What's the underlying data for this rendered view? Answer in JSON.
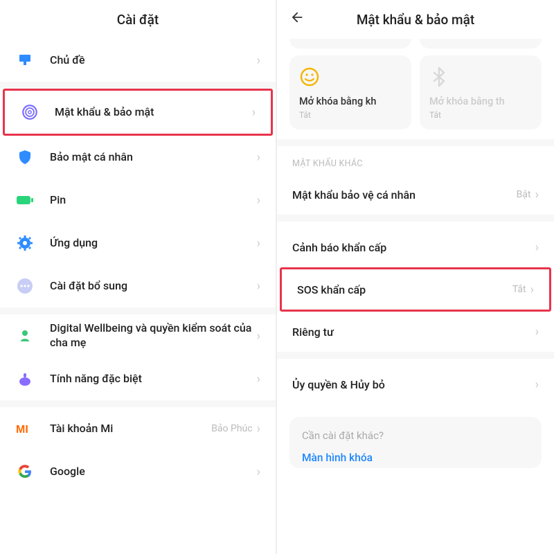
{
  "left": {
    "title": "Cài đặt",
    "items": [
      {
        "icon": "theme",
        "label": "Chủ đề"
      },
      {
        "icon": "fingerprint",
        "label": "Mật khẩu & bảo mật",
        "highlight": true
      },
      {
        "icon": "shield",
        "label": "Bảo mật cá nhân"
      },
      {
        "icon": "battery",
        "label": "Pin"
      },
      {
        "icon": "apps",
        "label": "Ứng dụng"
      },
      {
        "icon": "more",
        "label": "Cài đặt bổ sung"
      },
      {
        "icon": "wellbeing",
        "label": "Digital Wellbeing và quyền kiểm soát của cha mẹ"
      },
      {
        "icon": "special",
        "label": "Tính năng đặc biệt"
      },
      {
        "icon": "mi",
        "label": "Tài khoản Mi",
        "value": "Bảo Phúc"
      },
      {
        "icon": "google",
        "label": "Google"
      }
    ]
  },
  "right": {
    "title": "Mật khẩu & bảo mật",
    "cards": [
      {
        "icon": "smile",
        "title": "Mở khóa bằng kh",
        "sub": "Tắt",
        "disabled": false
      },
      {
        "icon": "bluetooth",
        "title": "Mở khóa bằng th",
        "sub": "Tắt",
        "disabled": true
      }
    ],
    "section_header": "MẬT KHẨU KHÁC",
    "rows": [
      {
        "label": "Mật khẩu bảo vệ cá nhân",
        "value": "Bật"
      },
      {
        "label": "Cảnh báo khẩn cấp",
        "value": ""
      },
      {
        "label": "SOS khẩn cấp",
        "value": "Tắt",
        "highlight": true
      },
      {
        "label": "Riêng tư",
        "value": ""
      },
      {
        "label": "Ủy quyền & Hủy bỏ",
        "value": ""
      }
    ],
    "footer": {
      "question": "Cần cài đặt khác?",
      "link": "Màn hình khóa"
    }
  }
}
